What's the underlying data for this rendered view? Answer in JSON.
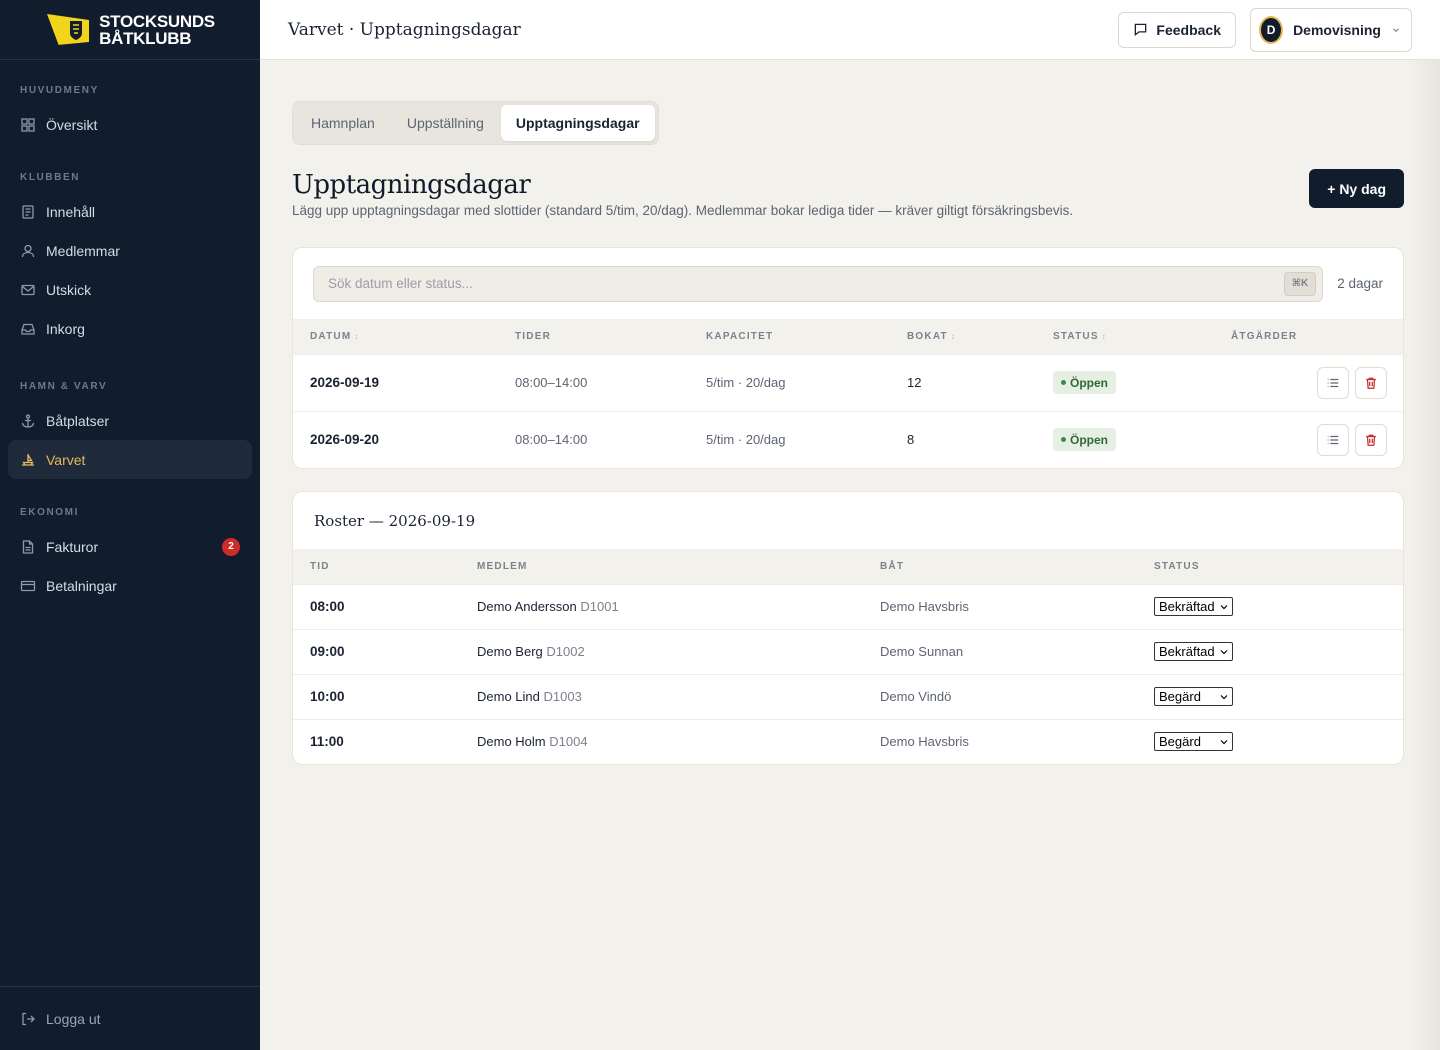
{
  "brand": {
    "line1": "STOCKSUNDS",
    "line2": "BÅTKLUBB",
    "colors": {
      "sidebar": "#111c2d",
      "accent": "#e6b85c",
      "flag": "#f2d41a"
    }
  },
  "sidebar": {
    "sections": [
      {
        "heading": "HUVUDMENY",
        "items": [
          {
            "label": "Översikt",
            "icon": "grid-icon"
          }
        ]
      },
      {
        "heading": "KLUBBEN",
        "items": [
          {
            "label": "Innehåll",
            "icon": "document-icon"
          },
          {
            "label": "Medlemmar",
            "icon": "user-icon"
          },
          {
            "label": "Utskick",
            "icon": "mail-icon"
          },
          {
            "label": "Inkorg",
            "icon": "inbox-icon"
          }
        ]
      },
      {
        "heading": "HAMN & VARV",
        "items": [
          {
            "label": "Båtplatser",
            "icon": "anchor-icon"
          },
          {
            "label": "Varvet",
            "icon": "shipyard-icon",
            "active": true
          }
        ]
      },
      {
        "heading": "EKONOMI",
        "items": [
          {
            "label": "Fakturor",
            "icon": "invoice-icon",
            "badge": "2"
          },
          {
            "label": "Betalningar",
            "icon": "card-icon"
          }
        ]
      }
    ],
    "logout": "Logga ut"
  },
  "topbar": {
    "breadcrumb": "Varvet · Upptagningsdagar",
    "feedback": "Feedback",
    "user_initial": "D",
    "user_name": "Demovisning"
  },
  "tabs": [
    {
      "label": "Hamnplan",
      "active": false
    },
    {
      "label": "Uppställning",
      "active": false
    },
    {
      "label": "Upptagningsdagar",
      "active": true
    }
  ],
  "page": {
    "title": "Upptagningsdagar",
    "description": "Lägg upp upptagningsdagar med slottider (standard 5/tim, 20/dag). Medlemmar bokar lediga tider — kräver giltigt försäkringsbevis.",
    "new_button": "+ Ny dag"
  },
  "search": {
    "placeholder": "Sök datum eller status...",
    "shortcut": "⌘K",
    "count": "2 dagar"
  },
  "days_table": {
    "headers": [
      "DATUM",
      "TIDER",
      "KAPACITET",
      "BOKAT",
      "STATUS",
      "ÅTGÄRDER"
    ],
    "rows": [
      {
        "date": "2026-09-19",
        "times": "08:00–14:00",
        "capacity": "5/tim · 20/dag",
        "booked": "12",
        "status": "Öppen"
      },
      {
        "date": "2026-09-20",
        "times": "08:00–14:00",
        "capacity": "5/tim · 20/dag",
        "booked": "8",
        "status": "Öppen"
      }
    ]
  },
  "roster": {
    "title": "Roster — 2026-09-19",
    "headers": [
      "TID",
      "MEDLEM",
      "BÅT",
      "STATUS"
    ],
    "rows": [
      {
        "time": "08:00",
        "member": "Demo Andersson",
        "member_id": "D1001",
        "boat": "Demo Havsbris",
        "status": "Bekräftad"
      },
      {
        "time": "09:00",
        "member": "Demo Berg",
        "member_id": "D1002",
        "boat": "Demo Sunnan",
        "status": "Bekräftad"
      },
      {
        "time": "10:00",
        "member": "Demo Lind",
        "member_id": "D1003",
        "boat": "Demo Vindö",
        "status": "Begärd"
      },
      {
        "time": "11:00",
        "member": "Demo Holm",
        "member_id": "D1004",
        "boat": "Demo Havsbris",
        "status": "Begärd"
      }
    ]
  }
}
